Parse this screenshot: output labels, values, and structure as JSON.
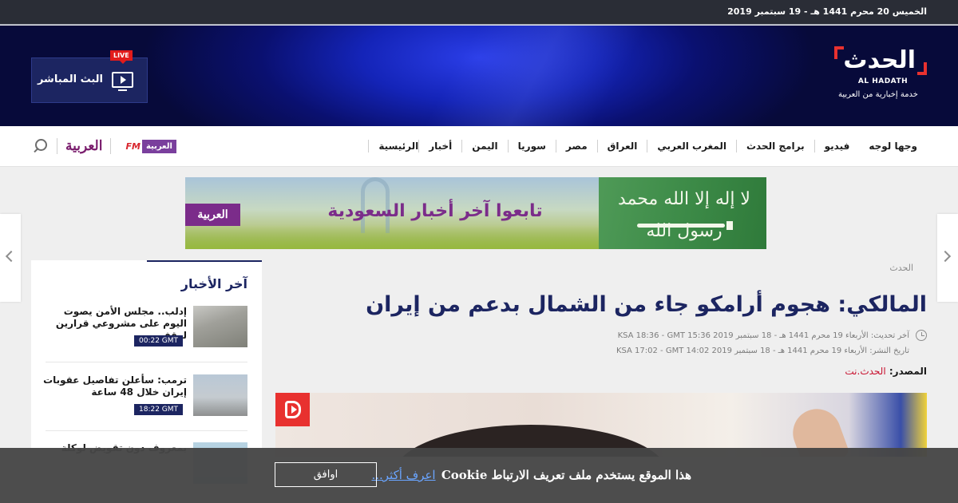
{
  "topbar": {
    "date": "الخميس 20 محرم 1441 هـ - 19 سبتمبر 2019"
  },
  "header": {
    "logo_arabic": "الحدث",
    "logo_english": "AL HADATH",
    "logo_tagline": "خدمة إخبارية من العربية",
    "live_badge": "LIVE",
    "live_label": "البث المباشر"
  },
  "nav": {
    "items": [
      "الرئيسية",
      "أخبار",
      "اليمن",
      "سوريا",
      "مصر",
      "العراق",
      "المغرب العربي",
      "برامج الحدث",
      "فيديو",
      "وجها لوجه"
    ],
    "alarabiya_logo": "العربية",
    "fm_label": "FM",
    "fm_brand": "العربية"
  },
  "ad": {
    "headline": "تابعوا آخر أخبار السعودية",
    "logo": "العربية",
    "flag_text": "لا إله إلا الله محمد رسول الله"
  },
  "sidebar": {
    "title": "آخر الأخبار",
    "items": [
      {
        "headline": "إدلب.. مجلس الأمن يصوت اليوم على مشروعي قرارين لوقف ...",
        "time": "00:22 GMT"
      },
      {
        "headline": "ترمب: سأعلن تفاصيل عقوبات إيران خلال 48 ساعة",
        "time": "18:22 GMT"
      },
      {
        "headline": "بمعروف دون تقويض لوكلة",
        "time": ""
      }
    ]
  },
  "article": {
    "breadcrumb": "الحدث",
    "title": "المالكي: هجوم أرامكو جاء من الشمال بدعم من إيران",
    "updated": "آخر تحديث: الأربعاء 19 محرم 1441 هـ - 18 سبتمبر 2019 KSA 18:36 - GMT 15:36",
    "published": "تاريخ النشر: الأربعاء 19 محرم 1441 هـ - 18 سبتمبر 2019 KSA 17:02 - GMT 14:02",
    "source_label": "المصدر:",
    "source_name": "الحدث.نت"
  },
  "cookie": {
    "message": "هذا الموقع يستخدم ملف تعريف الارتباط Cookie",
    "learn_more": "اعرف أكثر...",
    "agree": "اوافق"
  },
  "colors": {
    "brand_navy": "#1c2561",
    "brand_red": "#e8312f",
    "alarabiya_purple": "#7b2c8a",
    "link_blue": "#6aa5ff"
  }
}
